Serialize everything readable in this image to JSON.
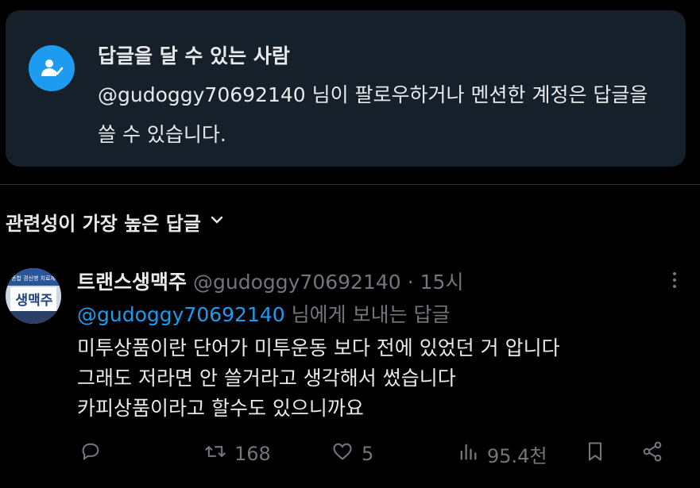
{
  "notice": {
    "title": "답글을 달 수 있는 사람",
    "body": "@gudoggy70692140 님이 팔로우하거나 멘션한 계정은 답글을 쓸 수 있습니다."
  },
  "sort": {
    "label": "관련성이 가장 높은 답글"
  },
  "reply": {
    "avatar_text": "생맥주",
    "avatar_subtext": "통합 경신병 치료제",
    "display_name": "트랜스생맥주",
    "handle": "@gudoggy70692140",
    "separator": "·",
    "time": "15시",
    "reply_to_mention": "@gudoggy70692140",
    "reply_to_suffix": " 님에게 보내는 답글",
    "lines": [
      "미투상품이란 단어가 미투운동 보다 전에 있었던 거 압니다",
      "그래도 저라면 안 쓸거라고 생각해서 썼습니다",
      "카피상품이라고 할수도 있으니까요"
    ],
    "actions": {
      "replies": "",
      "retweets": "168",
      "likes": "5",
      "views": "95.4천"
    }
  },
  "colors": {
    "background": "#000000",
    "panel": "#16202a",
    "accent": "#1d9bf0",
    "muted": "#71767b",
    "text": "#e7e9ea"
  },
  "icons": [
    "person-check-icon",
    "chevron-down-icon",
    "more-dots-icon",
    "reply-icon",
    "retweet-icon",
    "heart-icon",
    "views-icon",
    "bookmark-icon",
    "share-icon"
  ]
}
